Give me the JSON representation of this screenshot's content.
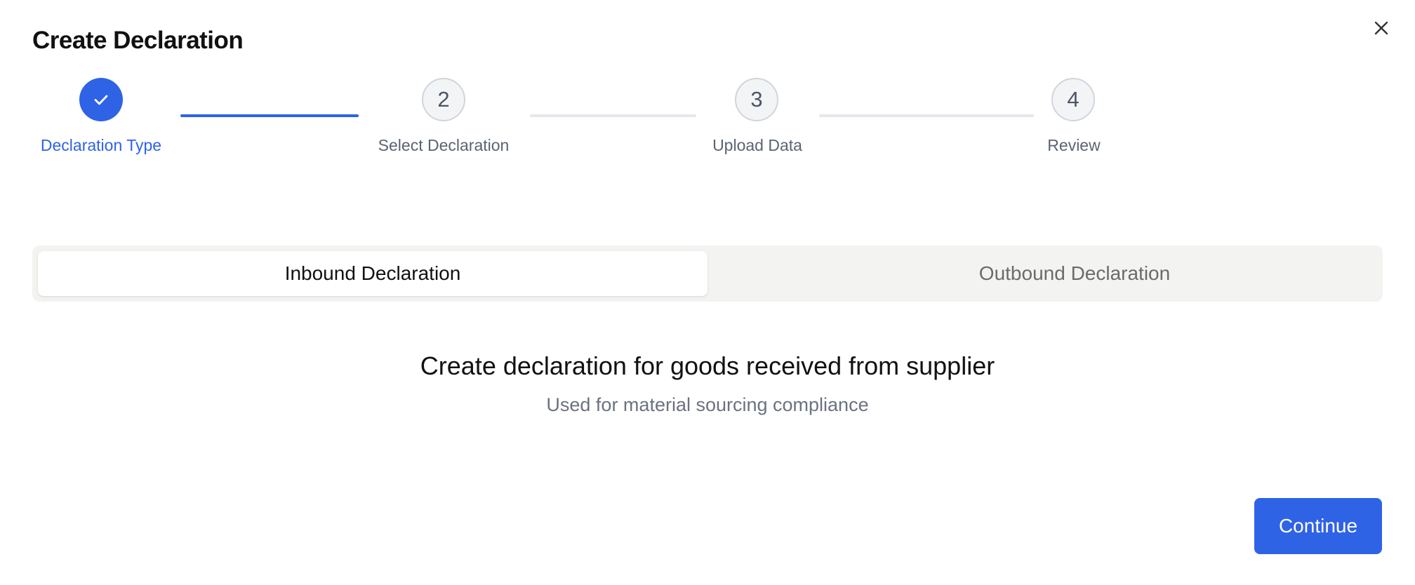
{
  "dialog": {
    "title": "Create Declaration",
    "close_icon": "close-icon"
  },
  "stepper": {
    "steps": [
      {
        "number": "",
        "label": "Declaration Type",
        "state": "completed",
        "icon": "check-icon"
      },
      {
        "number": "2",
        "label": "Select Declaration",
        "state": "pending"
      },
      {
        "number": "3",
        "label": "Upload Data",
        "state": "pending"
      },
      {
        "number": "4",
        "label": "Review",
        "state": "pending"
      }
    ]
  },
  "declaration_type": {
    "options": [
      {
        "label": "Inbound Declaration",
        "selected": true
      },
      {
        "label": "Outbound Declaration",
        "selected": false
      }
    ],
    "description_heading": "Create declaration for goods received from supplier",
    "description_sub": "Used for material sourcing compliance"
  },
  "footer": {
    "continue_label": "Continue"
  },
  "colors": {
    "accent": "#2f63e6",
    "segment_bg": "#f3f3f1",
    "muted_text": "#6b7280"
  }
}
